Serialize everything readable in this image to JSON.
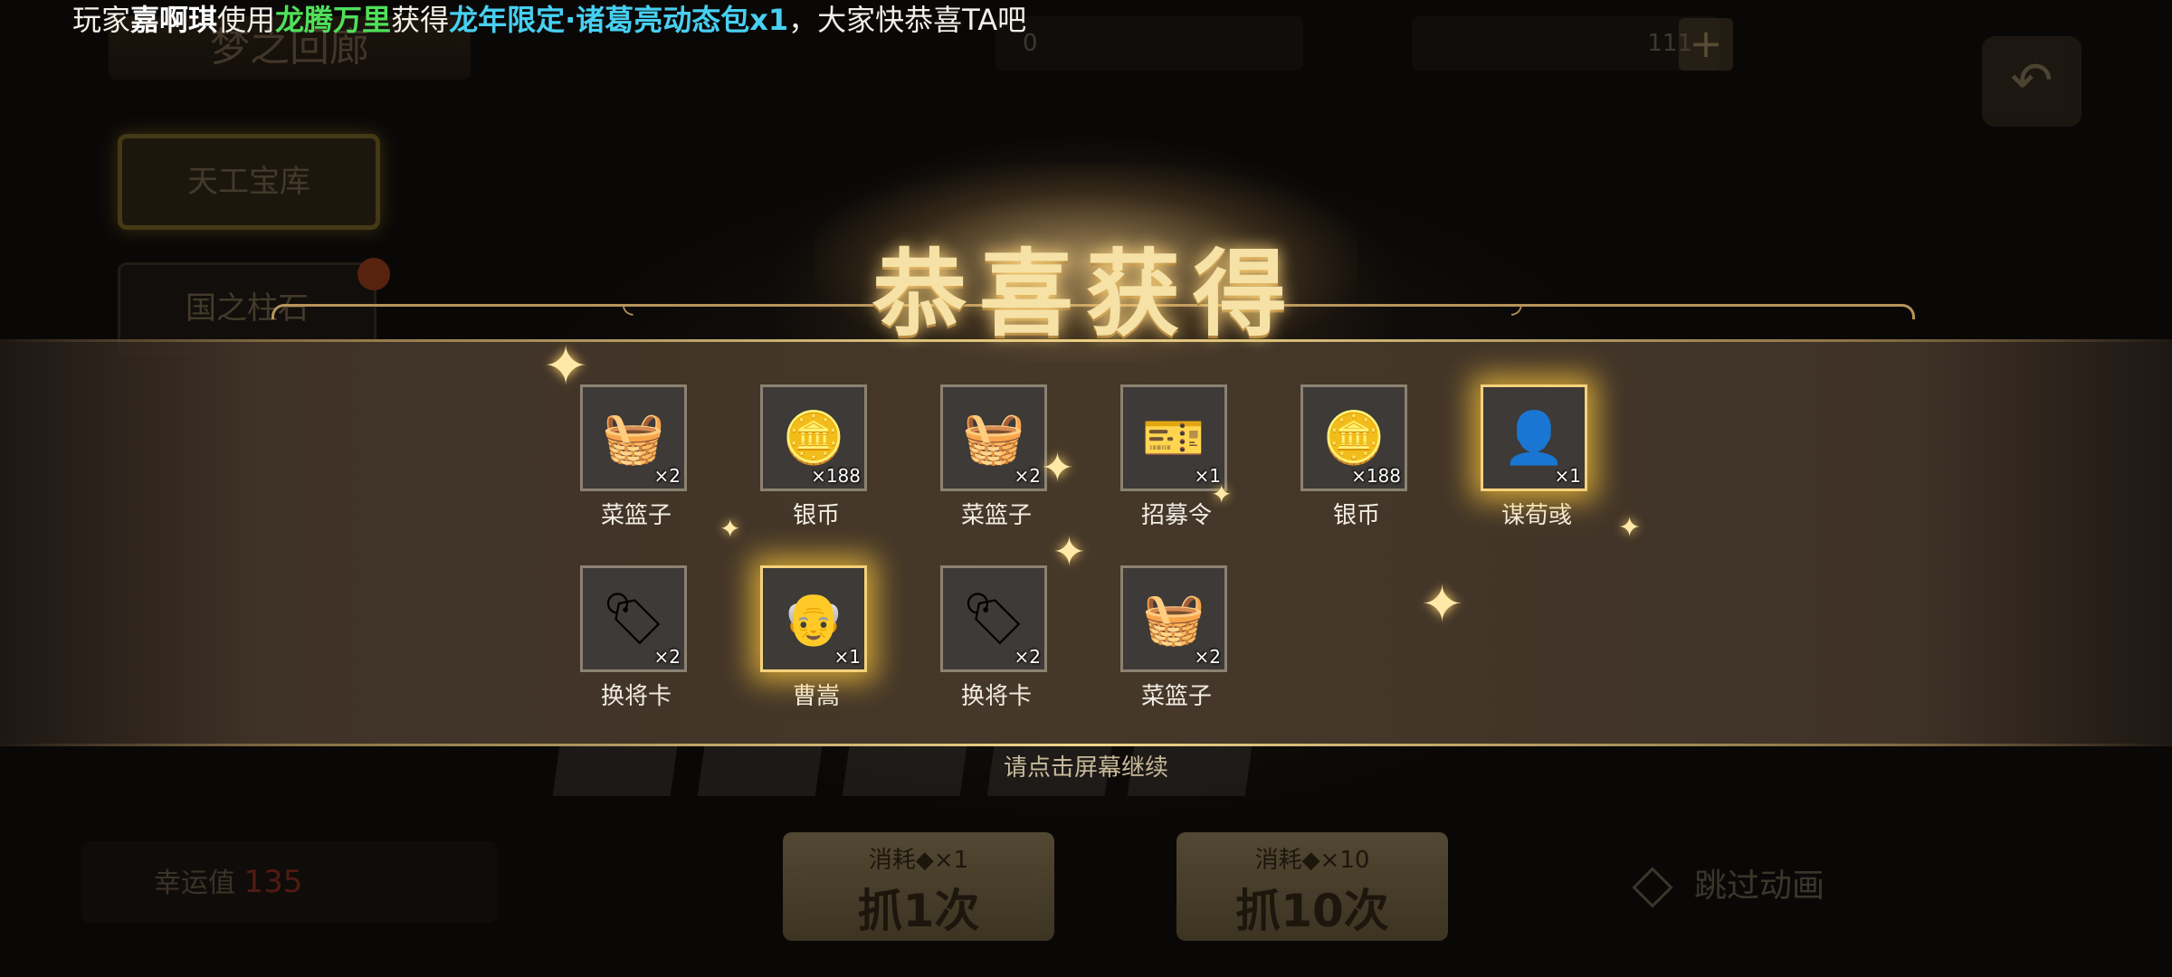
{
  "marquee": {
    "prefix": "玩家",
    "player": "嘉啊琪",
    "mid1": "使用",
    "item": "龙腾万里",
    "mid2": "获得",
    "reward": "龙年限定·诸葛亮动态包x1",
    "suffix": "，大家快恭喜TA吧"
  },
  "background": {
    "hall_title": "梦之回廊",
    "currency1_value": "0",
    "currency2_value": "111",
    "plus_label": "+",
    "back_label": "↶",
    "tabs": [
      "天工宝库",
      "国之柱石"
    ],
    "luck_label": "幸运值",
    "luck_value": "135",
    "draw_buttons": [
      {
        "cost": "消耗◆×1",
        "label": "抓1次"
      },
      {
        "cost": "消耗◆×10",
        "label": "抓10次"
      }
    ],
    "skip_label": "跳过动画"
  },
  "reward_panel": {
    "title": "恭喜获得",
    "items": [
      {
        "name": "菜篮子",
        "count": "×2",
        "icon": "basket-icon",
        "glow": false
      },
      {
        "name": "银币",
        "count": "×188",
        "icon": "silver-coin-icon",
        "glow": false
      },
      {
        "name": "菜篮子",
        "count": "×2",
        "icon": "basket-icon",
        "glow": false
      },
      {
        "name": "招募令",
        "count": "×1",
        "icon": "recruit-token-icon",
        "glow": false
      },
      {
        "name": "银币",
        "count": "×188",
        "icon": "silver-coin-icon",
        "glow": false
      },
      {
        "name": "谋荀彧",
        "count": "×1",
        "icon": "general-portrait-icon",
        "glow": true
      },
      {
        "name": "换将卡",
        "count": "×2",
        "icon": "swap-card-icon",
        "glow": false
      },
      {
        "name": "曹嵩",
        "count": "×1",
        "icon": "general-portrait-icon",
        "glow": true
      },
      {
        "name": "换将卡",
        "count": "×2",
        "icon": "swap-card-icon",
        "glow": false
      },
      {
        "name": "菜篮子",
        "count": "×2",
        "icon": "basket-icon",
        "glow": false
      }
    ],
    "hint": "请点击屏幕继续"
  },
  "colors": {
    "player": "#ffffff",
    "item_name": "#4fe05a",
    "reward": "#47d0f2",
    "title_gold": "#f6e2a6",
    "panel_bg": "#463829"
  }
}
